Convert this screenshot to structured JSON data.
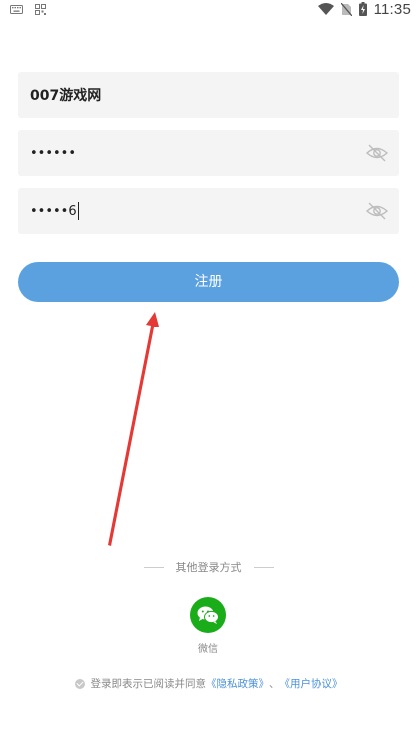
{
  "status_bar": {
    "time": "11:35",
    "left_icons": [
      "keyboard-icon",
      "qr-code-icon"
    ],
    "right_icons": [
      "wifi-icon",
      "no-sim-icon",
      "battery-charging-icon"
    ]
  },
  "form": {
    "username_value": "007游戏网",
    "password_mask": "••••••",
    "confirm_mask": "•••••",
    "confirm_last_char": "6"
  },
  "register_button": {
    "label": "注册"
  },
  "other_login": {
    "label": "其他登录方式",
    "wechat_label": "微信"
  },
  "agreement": {
    "prefix": "登录即表示已阅读并同意",
    "privacy_link": "《隐私政策》",
    "separator": "、",
    "user_link": "《用户协议》"
  },
  "colors": {
    "accent": "#5ba1e0",
    "wechat": "#1aad19",
    "link": "#4a90d9",
    "field_bg": "#f4f4f4",
    "annotation_arrow": "#e53935"
  }
}
